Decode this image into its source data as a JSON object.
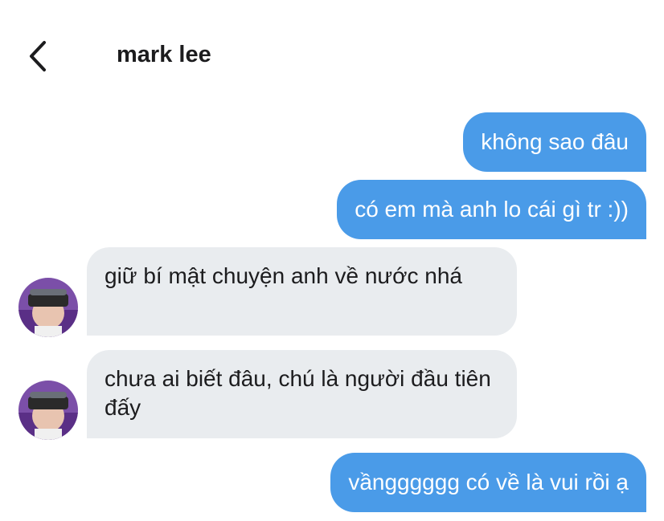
{
  "header": {
    "title": "mark lee",
    "back_icon": "chevron-left-icon"
  },
  "messages": [
    {
      "from": "me",
      "text": "không sao đâu"
    },
    {
      "from": "me",
      "text": "có em mà anh lo cái gì tr :))"
    },
    {
      "from": "them",
      "text": "giữ bí mật chuyện anh về nước nhá"
    },
    {
      "from": "them",
      "text": "chưa ai biết đâu, chú là người đầu tiên đấy"
    },
    {
      "from": "me",
      "text": "vầngggggg có về là vui rồi ạ"
    }
  ],
  "colors": {
    "sent_bubble": "#4A9BE8",
    "received_bubble": "#E9ECEF",
    "text_dark": "#1c1c1e"
  }
}
